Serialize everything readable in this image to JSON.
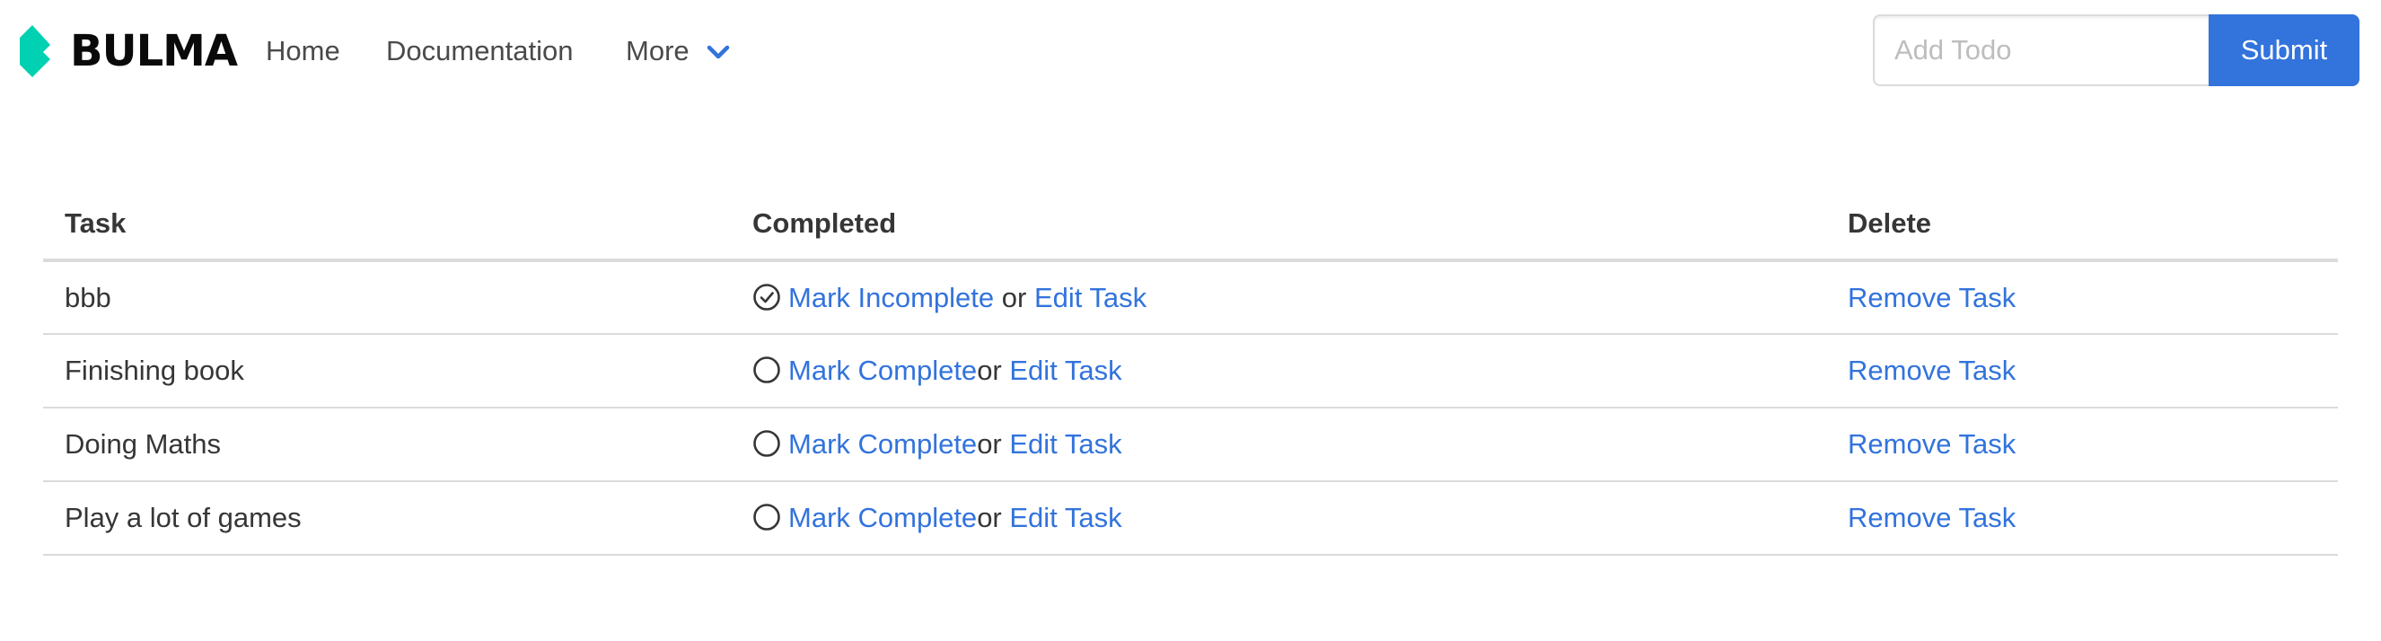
{
  "navbar": {
    "brand": "BULMA",
    "home": "Home",
    "documentation": "Documentation",
    "more": "More",
    "add_placeholder": "Add Todo",
    "submit": "Submit"
  },
  "colors": {
    "brand": "#00d1b2",
    "link": "#3273dc",
    "text": "#363636",
    "border": "#dbdbdb"
  },
  "table": {
    "headers": [
      "Task",
      "Completed",
      "Delete"
    ],
    "rows": [
      {
        "task": "bbb",
        "completed": true,
        "status_icon": "check-circle-icon",
        "toggle_label": "Mark Incomplete",
        "or_text": " or ",
        "edit_label": "Edit Task",
        "remove_label": "Remove Task"
      },
      {
        "task": "Finishing book",
        "completed": false,
        "status_icon": "empty-circle-icon",
        "toggle_label": "Mark Complete",
        "or_text": "or ",
        "edit_label": "Edit Task",
        "remove_label": "Remove Task"
      },
      {
        "task": "Doing Maths",
        "completed": false,
        "status_icon": "empty-circle-icon",
        "toggle_label": "Mark Complete",
        "or_text": "or ",
        "edit_label": "Edit Task",
        "remove_label": "Remove Task"
      },
      {
        "task": "Play a lot of games",
        "completed": false,
        "status_icon": "empty-circle-icon",
        "toggle_label": "Mark Complete",
        "or_text": "or ",
        "edit_label": "Edit Task",
        "remove_label": "Remove Task"
      }
    ]
  }
}
